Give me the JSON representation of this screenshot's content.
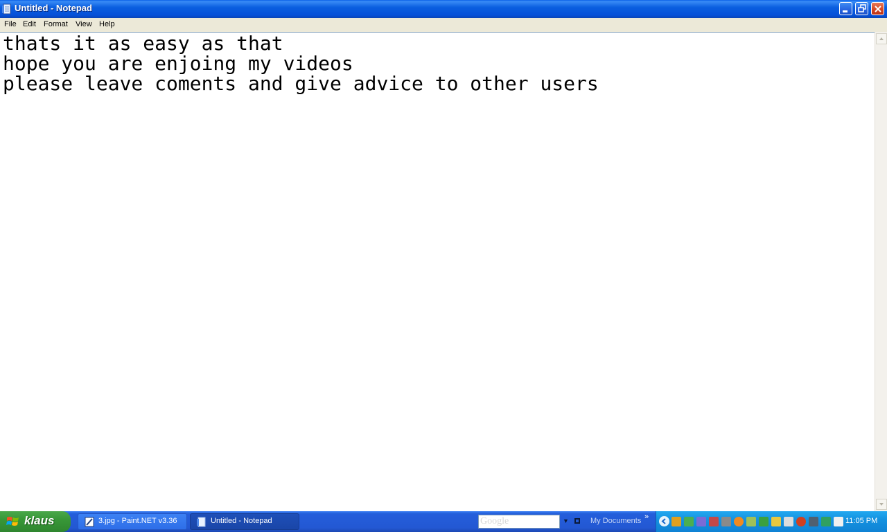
{
  "window": {
    "title": "Untitled - Notepad"
  },
  "menu": [
    "File",
    "Edit",
    "Format",
    "View",
    "Help"
  ],
  "document": {
    "lines": [
      "thats it as easy as that",
      "hope you are enjoing my videos",
      "please leave coments and give advice to other users"
    ]
  },
  "taskbar": {
    "start_label": "klaus",
    "tasks": [
      {
        "label": "3.jpg - Paint.NET v3.36",
        "icon": "paintnet-icon",
        "active": false
      },
      {
        "label": "Untitled - Notepad",
        "icon": "notepad-icon",
        "active": true
      }
    ],
    "search_placeholder": "Google",
    "toolbar_label": "My Documents",
    "more": "»",
    "clock": "11:05 PM"
  },
  "colors": {
    "titlebar": "#0550d8",
    "taskbar": "#245edb",
    "start": "#389738",
    "tray": "#1592e0"
  }
}
